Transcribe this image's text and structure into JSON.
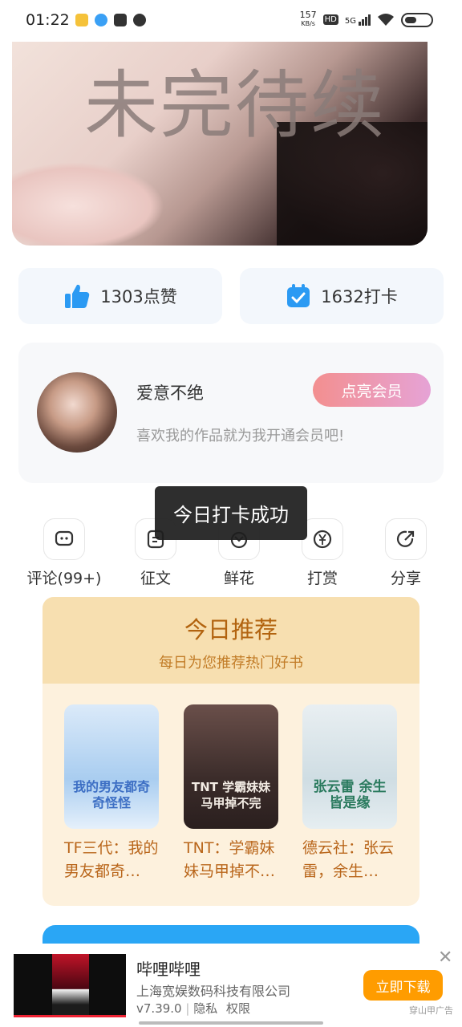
{
  "status_bar": {
    "time": "01:22",
    "net_speed": "157",
    "net_unit": "KB/s",
    "hd": "HD",
    "signal": "5G"
  },
  "banner": {
    "title_text": "未完待续"
  },
  "stats": {
    "likes": "1303点赞",
    "checkins": "1632打卡"
  },
  "author": {
    "name": "爱意不绝",
    "description": "喜欢我的作品就为我开通会员吧!",
    "vip_button": "点亮会员"
  },
  "actions": [
    {
      "label": "评论(99+)",
      "icon": "comment-icon"
    },
    {
      "label": "征文",
      "icon": "essay-icon"
    },
    {
      "label": "鲜花",
      "icon": "flower-icon"
    },
    {
      "label": "打赏",
      "icon": "yen-icon"
    },
    {
      "label": "分享",
      "icon": "share-icon"
    }
  ],
  "toast": "今日打卡成功",
  "recommend": {
    "title": "今日推荐",
    "subtitle": "每日为您推荐热门好书",
    "books": [
      {
        "title": "TF三代：我的男友都奇…",
        "cover_text": "我的男友都奇奇怪怪"
      },
      {
        "title": "TNT：学霸妹妹马甲掉不…",
        "cover_text": "TNT 学霸妹妹马甲掉不完"
      },
      {
        "title": "德云社：张云雷，余生…",
        "cover_text": "张云雷 余生皆是缘"
      }
    ]
  },
  "ad": {
    "app_name": "哔哩哔哩",
    "company": "上海宽娱数码科技有限公司",
    "version": "v7.39.0",
    "privacy": "隐私",
    "permissions": "权限",
    "download": "立即下载",
    "tag": "穿山甲广告",
    "close": "✕"
  },
  "colors": {
    "accent_blue": "#2aa6f5",
    "recommend_orange": "#b2630f",
    "download_orange": "#ff9c00"
  }
}
